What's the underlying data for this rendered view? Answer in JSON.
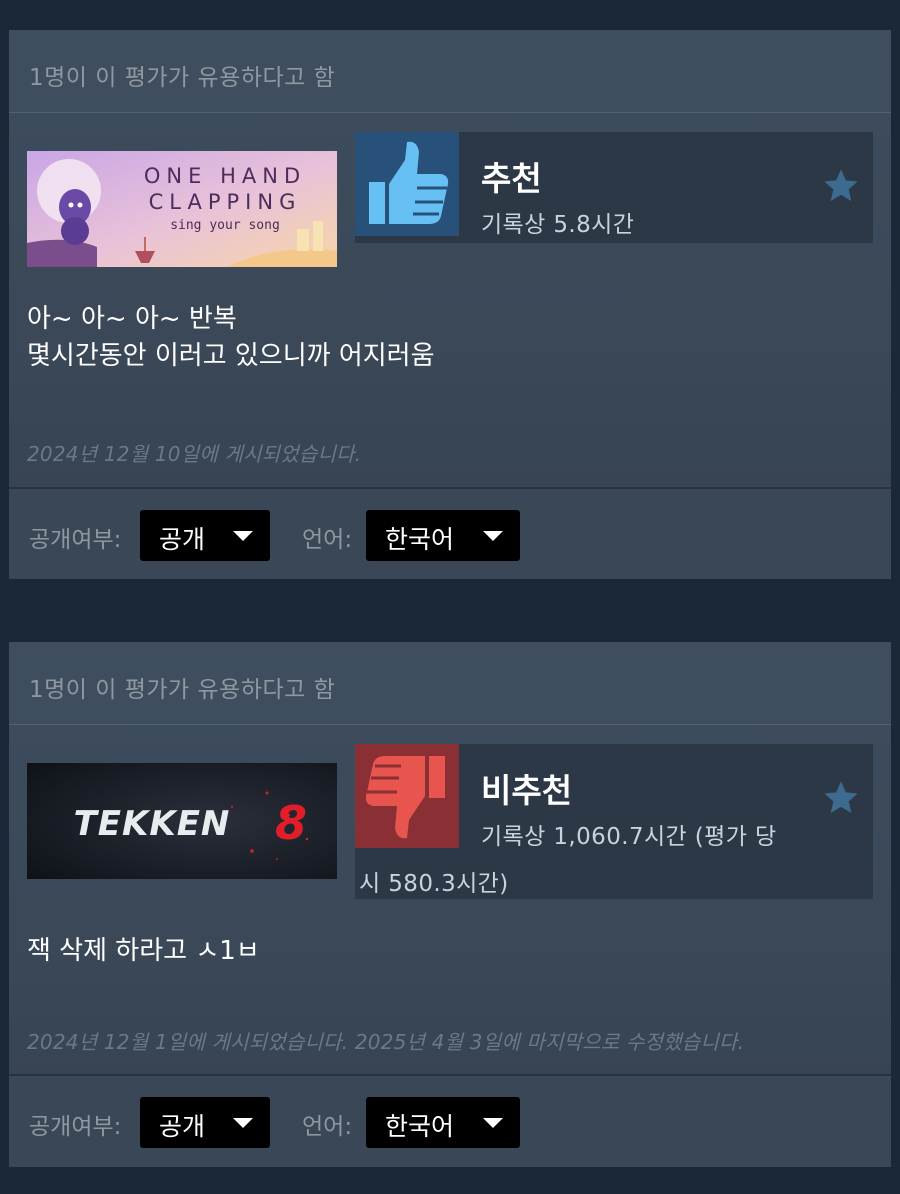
{
  "reviews": [
    {
      "helpful_text": "1명이 이 평가가 유용하다고 함",
      "game_logo": {
        "line1": "ONE HAND",
        "line2": "CLAPPING",
        "tagline": "sing your song"
      },
      "vote": "추천",
      "vote_icon": "thumbs-up-icon",
      "hours": "기록상 5.8시간",
      "text_lines": [
        "아~ 아~ 아~ 반복",
        "몇시간동안 이러고 있으니까 어지러움"
      ],
      "posted": "2024년 12월 10일에 게시되었습니다.",
      "visibility_label": "공개여부:",
      "visibility_value": "공개",
      "language_label": "언어:",
      "language_value": "한국어"
    },
    {
      "helpful_text": "1명이 이 평가가 유용하다고 함",
      "game_logo": {
        "title": "TEKKEN",
        "number": "8"
      },
      "vote": "비추천",
      "vote_icon": "thumbs-down-icon",
      "hours_line1": "기록상 1,060.7시간 (평가 당",
      "hours_line2": "시 580.3시간)",
      "text_lines": [
        "잭 삭제 하라고 ㅅ1ㅂ"
      ],
      "posted": "2024년 12월 1일에 게시되었습니다. 2025년 4월 3일에 마지막으로 수정했습니다.",
      "visibility_label": "공개여부:",
      "visibility_value": "공개",
      "language_label": "언어:",
      "language_value": "한국어"
    }
  ],
  "colors": {
    "page_bg": "#1b2838",
    "card_bg": "#3e4d5d",
    "thumb_up_bg": "#28517a",
    "thumb_up": "#66c0f4",
    "thumb_down_bg": "#8a2f34",
    "thumb_down": "#e8554e",
    "muted_text": "#8f98a0",
    "star": "#3d6b8f"
  }
}
